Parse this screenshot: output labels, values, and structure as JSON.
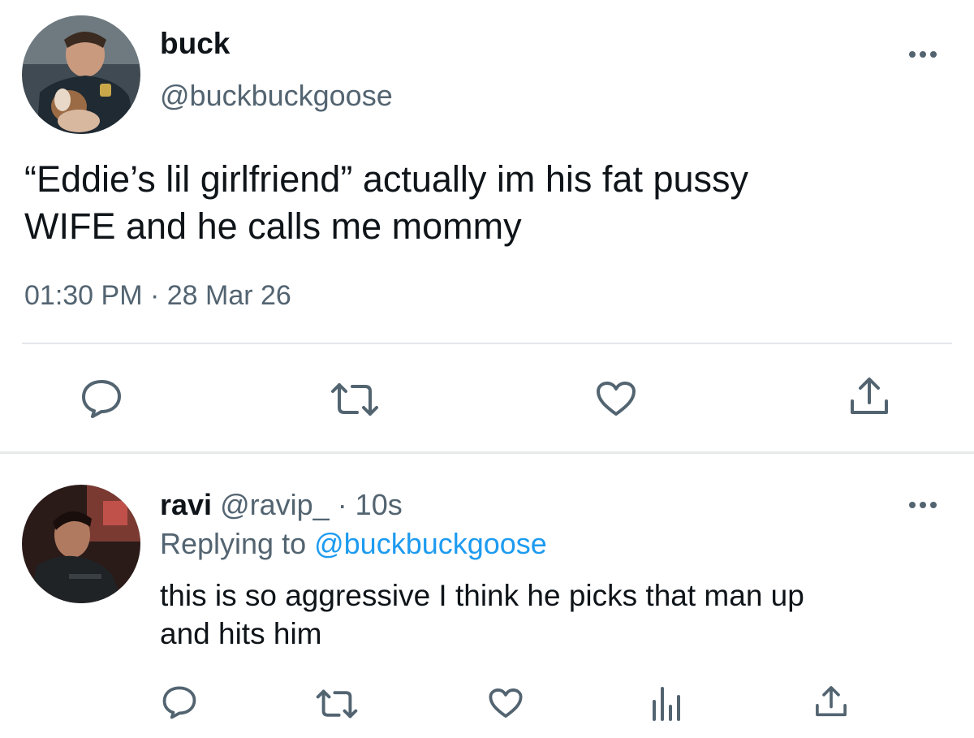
{
  "main_tweet": {
    "display_name": "buck",
    "handle": "@buckbuckgoose",
    "text": "“Eddie’s lil girlfriend” actually im his fat pussy\nWIFE and he calls me mommy",
    "timestamp": "01:30 PM · 28 Mar 26",
    "actions": [
      "reply-icon",
      "retweet-icon",
      "like-icon",
      "share-icon"
    ]
  },
  "reply_tweet": {
    "display_name": "ravi",
    "handle": "@ravip_",
    "time_meta": " · 10s",
    "replying_prefix": "Replying to ",
    "replying_to": "@buckbuckgoose",
    "text": "this is so aggressive I think he picks that man up\nand hits him",
    "actions": [
      "reply-icon",
      "retweet-icon",
      "like-icon",
      "analytics-icon",
      "share-icon"
    ]
  },
  "colors": {
    "text_primary": "#0f1419",
    "text_secondary": "#536471",
    "link": "#1d9bf0",
    "divider": "#e7e9ea"
  }
}
